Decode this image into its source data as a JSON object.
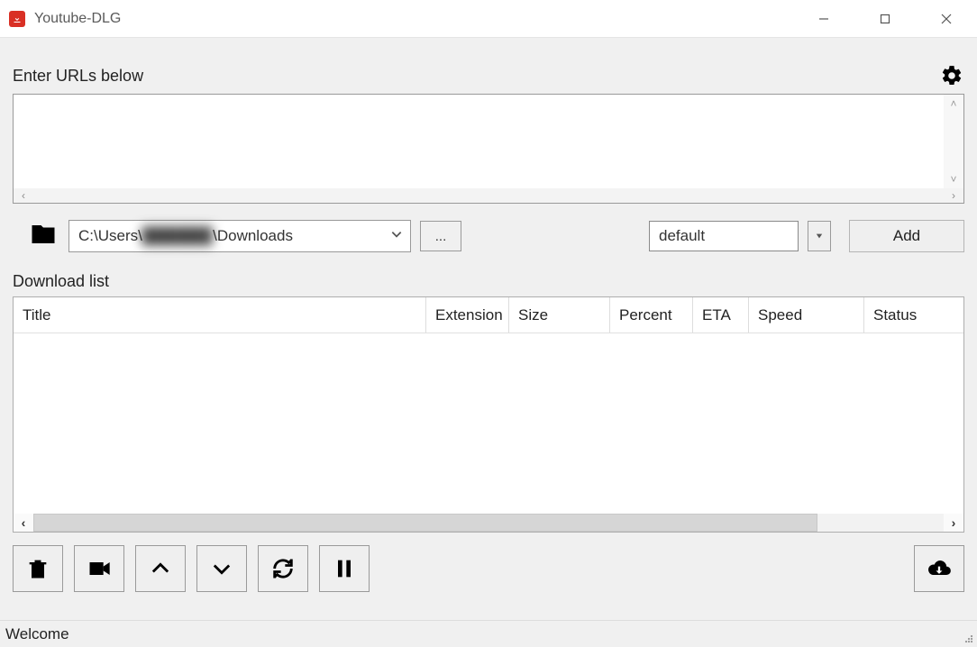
{
  "window": {
    "title": "Youtube-DLG"
  },
  "urls": {
    "label": "Enter URLs below",
    "value": ""
  },
  "path": {
    "prefix": "C:\\Users\\",
    "redacted": "██████",
    "suffix": "\\Downloads",
    "browse_label": "..."
  },
  "format": {
    "selected": "default"
  },
  "add_button": {
    "label": "Add"
  },
  "download_list": {
    "label": "Download list",
    "columns": {
      "title": "Title",
      "extension": "Extension",
      "size": "Size",
      "percent": "Percent",
      "eta": "ETA",
      "speed": "Speed",
      "status": "Status"
    }
  },
  "status": {
    "text": "Welcome"
  }
}
